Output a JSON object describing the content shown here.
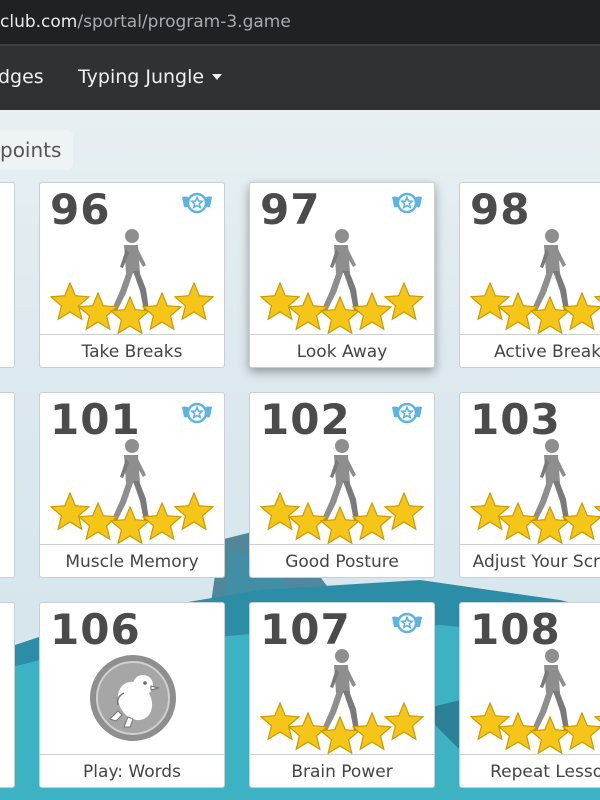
{
  "browser": {
    "url_host": "club.com",
    "url_path": "/sportal/program-3.game"
  },
  "nav": {
    "badges_label": "dges",
    "jungle_label": "Typing Jungle"
  },
  "points_label": "points",
  "cards": [
    {
      "num": "96",
      "label": "Take Breaks",
      "stars": 5
    },
    {
      "num": "97",
      "label": "Look Away",
      "stars": 5
    },
    {
      "num": "98",
      "label": "Active Breaks",
      "stars": 5
    },
    {
      "num": "101",
      "label": "Muscle Memory",
      "stars": 5
    },
    {
      "num": "102",
      "label": "Good Posture",
      "stars": 5
    },
    {
      "num": "103",
      "label": "Adjust Your Screen",
      "stars": 5
    },
    {
      "num": "106",
      "label": "Play: Words",
      "stars": 0
    },
    {
      "num": "107",
      "label": "Brain Power",
      "stars": 5
    },
    {
      "num": "108",
      "label": "Repeat Lesson",
      "stars": 5
    }
  ],
  "colors": {
    "star": "#f5c518",
    "figure": "#8e8e8e",
    "badge": "#5fb3e0"
  }
}
